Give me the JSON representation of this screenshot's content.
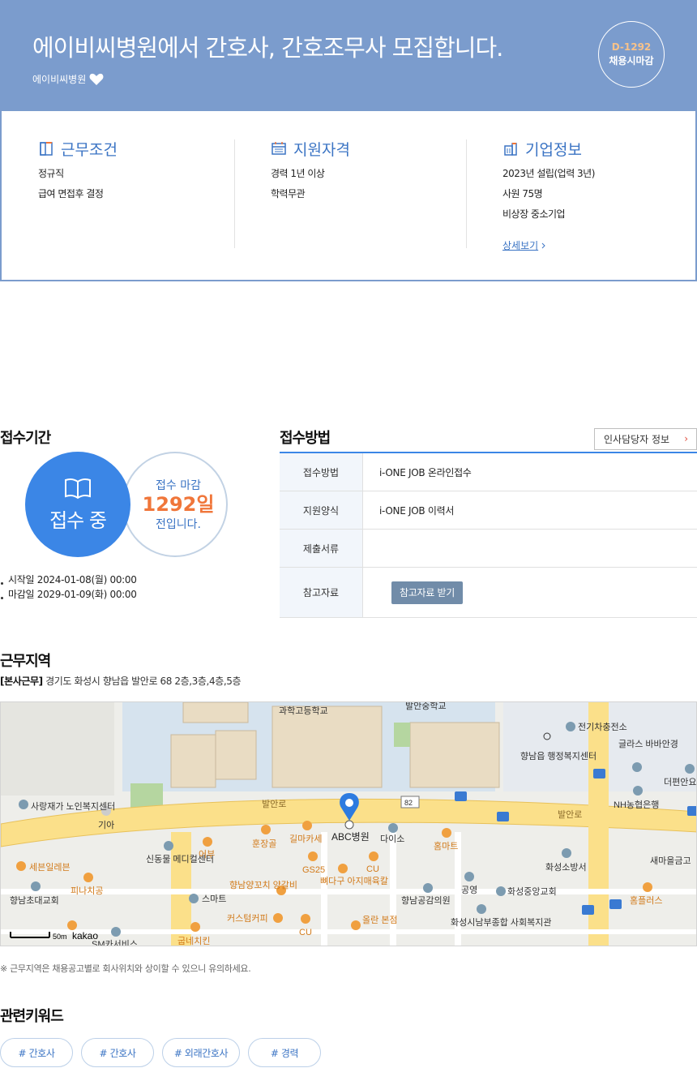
{
  "header": {
    "title": "에이비씨병원에서 간호사, 간호조무사 모집합니다.",
    "company": "에이비씨병원",
    "dday": "D-1292",
    "status": "채용시마감",
    "icon": "heart-icon"
  },
  "info": {
    "work": {
      "title": "근무조건",
      "icon": "door-icon",
      "lines": [
        "정규직",
        "급여 면접후 결정"
      ]
    },
    "qualification": {
      "title": "지원자격",
      "icon": "calendar-icon",
      "lines": [
        "경력 1년 이상",
        "학력무관"
      ]
    },
    "company": {
      "title": "기업정보",
      "icon": "building-icon",
      "lines": [
        "2023년 설립(업력 3년)",
        "사원 75명",
        "비상장 중소기업"
      ],
      "detail_link": "상세보기"
    }
  },
  "period": {
    "title": "접수기간",
    "status": "접수 중",
    "deadline_label": "접수 마감",
    "deadline_days": "1292일",
    "deadline_suffix": "전입니다.",
    "start": "시작일 2024-01-08(월) 00:00",
    "end": "마감일 2029-01-09(화) 00:00"
  },
  "method": {
    "title": "접수방법",
    "hr_button": "인사담당자 정보",
    "rows": [
      {
        "label": "접수방법",
        "value": "i-ONE JOB 온라인접수"
      },
      {
        "label": "지원양식",
        "value": "i-ONE JOB 이력서"
      },
      {
        "label": "제출서류",
        "value": ""
      },
      {
        "label": "참고자료",
        "button": "참고자료 받기"
      }
    ]
  },
  "location": {
    "title": "근무지역",
    "tag": "[본사근무]",
    "address": "경기도 화성시 향남읍 발안로 68 2층,3층,4층,5층",
    "note": "※ 근무지역은 채용공고별로 회사위치와 상이할 수 있으니 유의하세요.",
    "map": {
      "marker": "ABC병원",
      "scale": "50m",
      "brand": "kakao",
      "labels": [
        "과학고등학교",
        "발안중학교",
        "전기차충전소",
        "향남읍 행정복지센터",
        "글라스 바바안경",
        "더편안요",
        "사랑재가 노인복지센터",
        "기아",
        "발안로",
        "82",
        "발안로",
        "NH농협은행",
        "세븐일레븐",
        "신동물 메디컬센터",
        "어부",
        "훈장골",
        "길마카세",
        "다이소",
        "홈마트",
        "화성소방서",
        "새마을금고",
        "피나치공",
        "향남양꼬치 양갈비",
        "GS25",
        "뼈다구 아지매육칼",
        "CU",
        "향남공감의원",
        "공영",
        "화성중앙교회",
        "홈플러스",
        "향남초대교회",
        "스마트",
        "커스텀커피",
        "올란 본점",
        "화성시남부종합 사회복지관",
        "굽네치킨",
        "SM카서비스",
        "CU"
      ]
    }
  },
  "keywords": {
    "title": "관련키워드",
    "items": [
      "# 간호사",
      "# 간호사",
      "# 외래간호사",
      "# 경력"
    ]
  }
}
